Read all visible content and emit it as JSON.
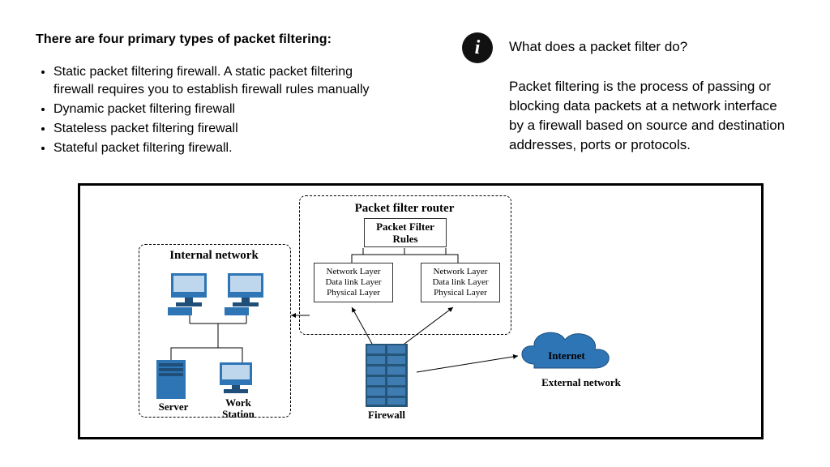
{
  "left": {
    "heading": "There are four primary types of packet filtering:",
    "bullets": [
      "Static packet filtering firewall. A static packet filtering firewall requires you to establish firewall rules manually",
      "Dynamic packet filtering firewall",
      "Stateless packet filtering firewall",
      "Stateful packet filtering firewall."
    ]
  },
  "info": {
    "icon_glyph": "i",
    "question": "What does a packet filter do?",
    "body": "Packet filtering is the process of passing or blocking data packets at a network interface by a firewall based on source and destination addresses, ports or protocols."
  },
  "diagram": {
    "router_title": "Packet filter router",
    "rules_label_l1": "Packet Filter",
    "rules_label_l2": "Rules",
    "layerbox_l1": "Network Layer",
    "layerbox_l2": "Data link Layer",
    "layerbox_l3": "Physical Layer",
    "internal_label": "Internal network",
    "server_label": "Server",
    "ws_label_l1": "Work",
    "ws_label_l2": "Station",
    "firewall_label": "Firewall",
    "internet_label": "Internet",
    "external_label": "External network"
  }
}
